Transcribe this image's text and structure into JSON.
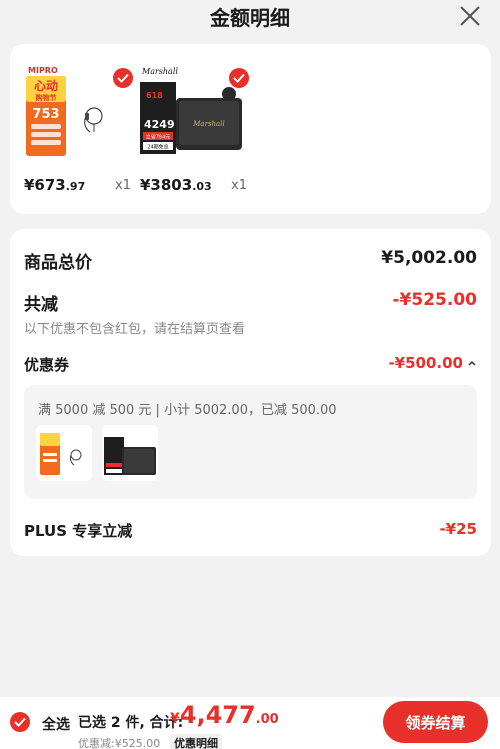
{
  "header": {
    "title": "金额明细"
  },
  "products": [
    {
      "brand_logo": "MIPRO",
      "badge_big": "心动",
      "badge_small": "购物节",
      "promo_number": "753",
      "price_int": "¥673",
      "price_dec": ".97",
      "qty": "x1",
      "selected": true
    },
    {
      "brand_logo": "Marshall",
      "promo_number": "4249",
      "promo_618": "618",
      "promo_footer": "24期免息",
      "promo_sub": "立省784元",
      "price_int": "¥3803",
      "price_dec": ".03",
      "qty": "x1",
      "selected": true
    }
  ],
  "summary": {
    "total_label": "商品总价",
    "total_value": "¥5,002.00",
    "reduce_label": "共减",
    "reduce_value": "-¥525.00",
    "reduce_note": "以下优惠不包含红包，请在结算页查看",
    "coupon_label": "优惠券",
    "coupon_value": "-¥500.00",
    "coupon_desc": "满 5000 减 500 元 | 小计 5002.00，已减 500.00",
    "plus_label": "PLUS 专享立减",
    "plus_value": "-¥25"
  },
  "bottom": {
    "select_all": "全选",
    "selected_text": "已选 2 件, 合计:",
    "total_yen": "¥",
    "total_int": "4,477",
    "total_dec": ".00",
    "discount_text": "优惠减:¥525.00",
    "detail_tag": "优惠明细",
    "checkout_label": "领券结算"
  },
  "colors": {
    "accent": "#e8302a",
    "background": "#f2f2f2",
    "card": "#ffffff"
  },
  "icons": [
    "close-icon",
    "check-icon",
    "chevron-up-icon"
  ]
}
